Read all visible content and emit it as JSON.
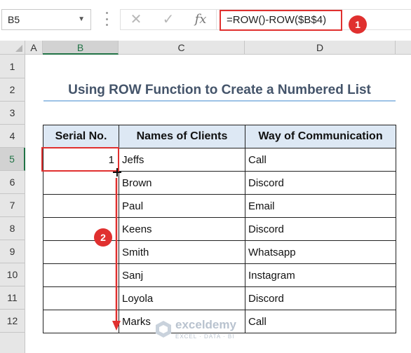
{
  "formula_bar": {
    "name_box": "B5",
    "cancel_symbol": "✕",
    "enter_symbol": "✓",
    "fx_label": "fx",
    "formula": "=ROW()-ROW($B$4)"
  },
  "columns": [
    "A",
    "B",
    "C",
    "D"
  ],
  "rows": [
    "1",
    "2",
    "3",
    "4",
    "5",
    "6",
    "7",
    "8",
    "9",
    "10",
    "11",
    "12"
  ],
  "title": "Using ROW Function to Create a Numbered List",
  "table": {
    "headers": [
      "Serial No.",
      "Names of Clients",
      "Way of Communication"
    ],
    "rows": [
      {
        "serial": "1",
        "name": "Jeffs",
        "way": "Call"
      },
      {
        "serial": "",
        "name": "Brown",
        "way": "Discord"
      },
      {
        "serial": "",
        "name": "Paul",
        "way": "Email"
      },
      {
        "serial": "",
        "name": "Keens",
        "way": "Discord"
      },
      {
        "serial": "",
        "name": "Smith",
        "way": "Whatsapp"
      },
      {
        "serial": "",
        "name": "Sanj",
        "way": "Instagram"
      },
      {
        "serial": "",
        "name": "Loyola",
        "way": "Discord"
      },
      {
        "serial": "",
        "name": "Marks",
        "way": "Call"
      }
    ]
  },
  "annotations": {
    "badge_1": "1",
    "badge_2": "2"
  },
  "watermark": {
    "name": "exceldemy",
    "tagline": "EXCEL · DATA · BI"
  },
  "colors": {
    "accent_red": "#e0302f",
    "excel_green": "#217346",
    "header_fill": "#dde8f4",
    "title_color": "#44546a"
  }
}
